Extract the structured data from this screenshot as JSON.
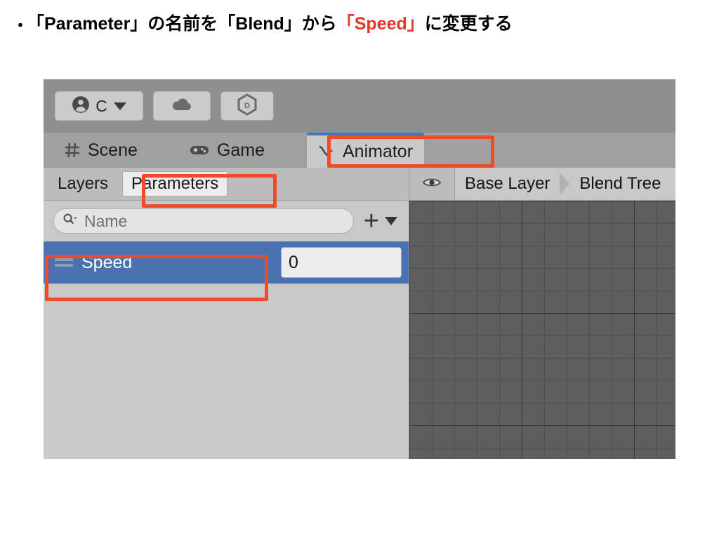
{
  "slide": {
    "bullet": "・",
    "heading_parts": [
      {
        "text": "「Parameter」の名前を「Blend」から",
        "color": "#000000"
      },
      {
        "text": "「Speed」",
        "color": "#e8352a"
      },
      {
        "text": "に変更する",
        "color": "#000000"
      }
    ],
    "heading_full": "・「Parameter」の名前を「Blend」から「Speed」に変更する"
  },
  "editor": {
    "toolbar": {
      "account_button": {
        "icon": "account-circle-icon",
        "label": "C",
        "caret": "chevron-down-icon"
      },
      "cloud_button": {
        "icon": "cloud-icon"
      },
      "package_button": {
        "icon": "hexagon-d-icon",
        "label": "D"
      }
    },
    "tabs": [
      {
        "label": "Scene",
        "icon": "grid-hash-icon",
        "active": false
      },
      {
        "label": "Game",
        "icon": "gamepad-icon",
        "active": false
      },
      {
        "label": "Animator",
        "icon": "animator-arrow-icon",
        "active": true
      }
    ],
    "subtabs": [
      {
        "label": "Layers",
        "active": false
      },
      {
        "label": "Parameters",
        "active": true
      }
    ],
    "search": {
      "placeholder": "Name",
      "value": "",
      "icon": "search-icon",
      "add_button": {
        "glyph": "+",
        "caret": "chevron-down-icon"
      }
    },
    "parameters": [
      {
        "name": "Speed",
        "value": "0",
        "selected": true,
        "handle_icon": "drag-handle-icon"
      }
    ],
    "graph": {
      "visibility_icon": "eye-icon",
      "breadcrumb": [
        {
          "label": "Base Layer"
        },
        {
          "label": "Blend Tree"
        }
      ]
    }
  },
  "annotations": {
    "color": "#f04a28",
    "boxes": [
      {
        "target": "animator-tab"
      },
      {
        "target": "parameters-subtab"
      },
      {
        "target": "speed-parameter-row"
      }
    ]
  }
}
